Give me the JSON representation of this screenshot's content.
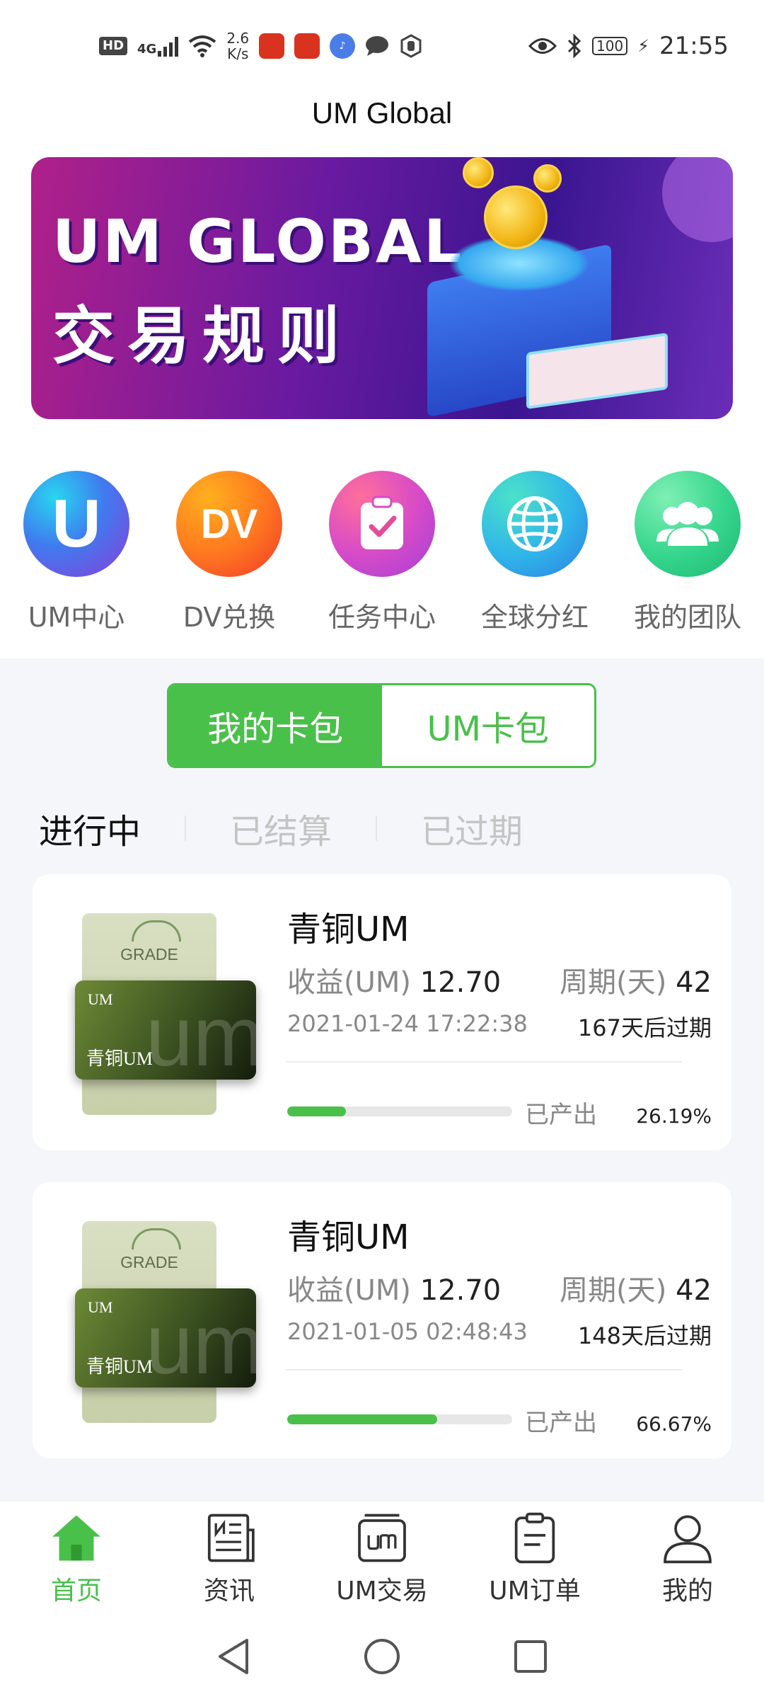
{
  "status_bar": {
    "hd": "HD",
    "network": "4G",
    "speed_value": "2.6",
    "speed_unit": "K/s",
    "battery": "100",
    "time": "21:55"
  },
  "header": {
    "title": "UM Global"
  },
  "banner": {
    "line1": "UM GLOBAL",
    "line2": "交易规则"
  },
  "quick_menu": [
    {
      "label": "UM中心",
      "icon": "um-center-icon",
      "glyph": "U"
    },
    {
      "label": "DV兑换",
      "icon": "dv-exchange-icon",
      "glyph": "DV"
    },
    {
      "label": "任务中心",
      "icon": "task-clipboard-icon"
    },
    {
      "label": "全球分红",
      "icon": "globe-icon"
    },
    {
      "label": "我的团队",
      "icon": "team-icon"
    }
  ],
  "wallet_toggle": {
    "active": "我的卡包",
    "inactive": "UM卡包"
  },
  "status_tabs": [
    {
      "label": "进行中",
      "active": true
    },
    {
      "label": "已结算",
      "active": false
    },
    {
      "label": "已过期",
      "active": false
    }
  ],
  "cards": [
    {
      "title": "青铜UM",
      "thumb_grade": "GRADE",
      "thumb_um": "UM",
      "thumb_name": "青铜UM",
      "thumb_watermark": "um",
      "income_label": "收益(UM)",
      "income_value": "12.70",
      "period_label": "周期(天)",
      "period_value": "42",
      "date": "2021-01-24 17:22:38",
      "expiry": "167天后过期",
      "progress_label": "已产出",
      "progress_text": "26.19%",
      "progress": 0.2619
    },
    {
      "title": "青铜UM",
      "thumb_grade": "GRADE",
      "thumb_um": "UM",
      "thumb_name": "青铜UM",
      "thumb_watermark": "um",
      "income_label": "收益(UM)",
      "income_value": "12.70",
      "period_label": "周期(天)",
      "period_value": "42",
      "date": "2021-01-05 02:48:43",
      "expiry": "148天后过期",
      "progress_label": "已产出",
      "progress_text": "66.67%",
      "progress": 0.6667
    }
  ],
  "bottom_nav": [
    {
      "label": "首页",
      "icon": "home-icon",
      "active": true
    },
    {
      "label": "资讯",
      "icon": "news-icon",
      "active": false
    },
    {
      "label": "UM交易",
      "icon": "um-trade-icon",
      "active": false
    },
    {
      "label": "UM订单",
      "icon": "order-icon",
      "active": false
    },
    {
      "label": "我的",
      "icon": "profile-icon",
      "active": false
    }
  ],
  "colors": {
    "accent": "#49c04a",
    "text_muted": "#888888",
    "page_bg": "#f4f6f9"
  }
}
